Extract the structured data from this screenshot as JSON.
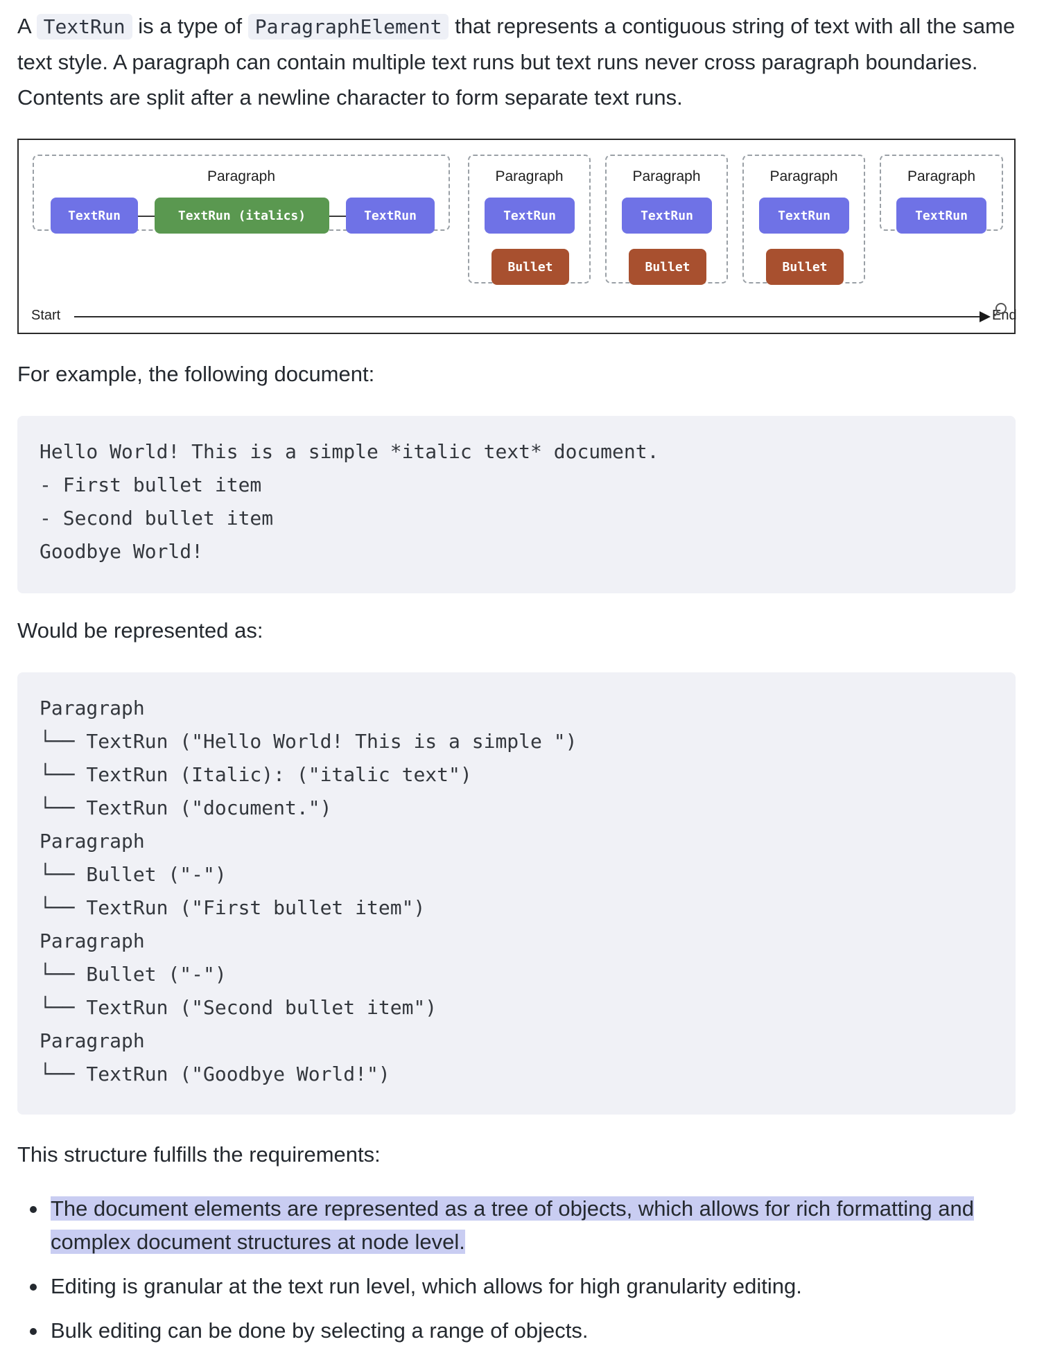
{
  "intro": {
    "prefix": "A ",
    "code1": "TextRun",
    "middle1": " is a type of ",
    "code2": "ParagraphElement",
    "rest": " that represents a contiguous string of text with all the same text style. A paragraph can contain multiple text runs but text runs never cross paragraph boundaries. Contents are split after a newline character to form separate text runs."
  },
  "diagram": {
    "paragraph_label": "Paragraph",
    "textrun_label": "TextRun",
    "textrun_italic_label": "TextRun (italics)",
    "bullet_label": "Bullet",
    "start_label": "Start",
    "end_label": "End",
    "colors": {
      "textrun": "#6f72e6",
      "italic": "#5a9850",
      "bullet": "#a8502f"
    }
  },
  "example_intro": "For example, the following document:",
  "example_code": [
    "Hello World! This is a simple *italic text* document.",
    "- First bullet item",
    "- Second bullet item",
    "Goodbye World!"
  ],
  "represented_intro": "Would be represented as:",
  "tree_code": [
    "Paragraph",
    "└── TextRun (\"Hello World! This is a simple \")",
    "└── TextRun (Italic): (\"italic text\")",
    "└── TextRun (\"document.\")",
    "Paragraph",
    "└── Bullet (\"-\")",
    "└── TextRun (\"First bullet item\")",
    "Paragraph",
    "└── Bullet (\"-\")",
    "└── TextRun (\"Second bullet item\")",
    "Paragraph",
    "└── TextRun (\"Goodbye World!\")"
  ],
  "requirements_intro": "This structure fulfills the requirements:",
  "requirements": [
    "The document elements are represented as a tree of objects, which allows for rich formatting and complex document structures at node level.",
    "Editing is granular at the text run level, which allows for high granularity editing.",
    "Bulk editing can be done by selecting a range of objects."
  ]
}
